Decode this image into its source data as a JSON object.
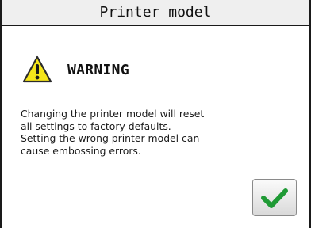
{
  "window": {
    "title": "Printer model"
  },
  "warning": {
    "icon": "warning-triangle-icon",
    "title": "WARNING",
    "icon_color": "#f5e51a"
  },
  "message": {
    "lines": [
      "Changing the printer model will reset",
      "all settings to factory defaults.",
      "Setting the wrong printer model can",
      "cause embossing errors."
    ]
  },
  "actions": {
    "confirm_icon": "checkmark-icon",
    "confirm_color": "#1f9a35"
  }
}
